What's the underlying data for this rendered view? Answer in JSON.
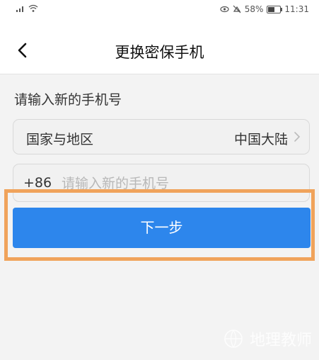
{
  "status_bar": {
    "signal_icon": "signal-icon",
    "wifi_icon": "wifi-icon",
    "eye_icon": "eye-icon",
    "mute_icon": "mute-icon",
    "battery_percent": "58%",
    "battery_level": 0.58,
    "time": "11:31"
  },
  "header": {
    "back_icon": "chevron-left-icon",
    "title": "更换密保手机"
  },
  "form": {
    "section_label": "请输入新的手机号",
    "region_label": "国家与地区",
    "region_value": "中国大陆",
    "country_code": "+86",
    "phone_placeholder": "请输入新的手机号",
    "phone_value": ""
  },
  "actions": {
    "next_label": "下一步"
  },
  "watermark": {
    "text": "地理教师"
  },
  "colors": {
    "primary": "#2d86ec",
    "highlight": "#f0a35b",
    "background": "#f3f3f3"
  }
}
